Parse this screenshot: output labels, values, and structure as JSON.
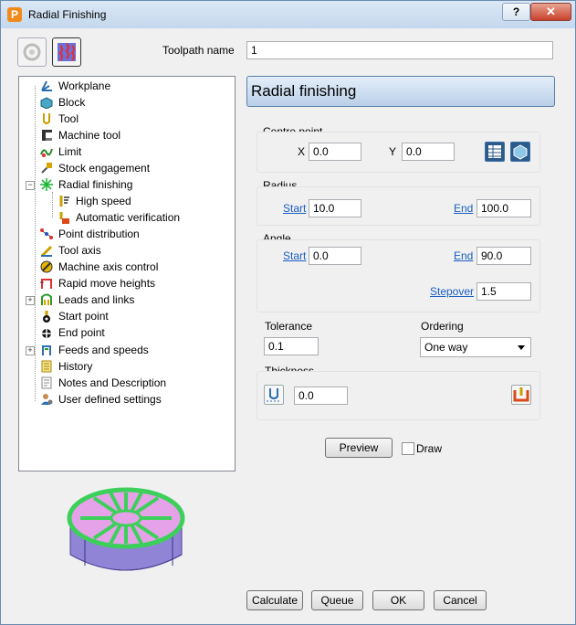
{
  "window": {
    "title": "Radial Finishing",
    "app_icon_letter": "P",
    "help_label": "?",
    "close_label": "✕"
  },
  "toolpath": {
    "label": "Toolpath name",
    "value": "1"
  },
  "tree": {
    "items": [
      {
        "label": "Workplane",
        "icon": "workplane-icon"
      },
      {
        "label": "Block",
        "icon": "block-icon"
      },
      {
        "label": "Tool",
        "icon": "tool-icon"
      },
      {
        "label": "Machine tool",
        "icon": "machine-tool-icon"
      },
      {
        "label": "Limit",
        "icon": "limit-icon"
      },
      {
        "label": "Stock engagement",
        "icon": "stock-engagement-icon"
      },
      {
        "label": "Radial finishing",
        "icon": "radial-finishing-icon"
      },
      {
        "label": "High speed",
        "icon": "high-speed-icon"
      },
      {
        "label": "Automatic verification",
        "icon": "automatic-verification-icon"
      },
      {
        "label": "Point distribution",
        "icon": "point-distribution-icon"
      },
      {
        "label": "Tool axis",
        "icon": "tool-axis-icon"
      },
      {
        "label": "Machine axis control",
        "icon": "machine-axis-control-icon"
      },
      {
        "label": "Rapid move heights",
        "icon": "rapid-move-heights-icon"
      },
      {
        "label": "Leads and links",
        "icon": "leads-and-links-icon"
      },
      {
        "label": "Start point",
        "icon": "start-point-icon"
      },
      {
        "label": "End point",
        "icon": "end-point-icon"
      },
      {
        "label": "Feeds and speeds",
        "icon": "feeds-and-speeds-icon"
      },
      {
        "label": "History",
        "icon": "history-icon"
      },
      {
        "label": "Notes and Description",
        "icon": "notes-icon"
      },
      {
        "label": "User defined settings",
        "icon": "user-settings-icon"
      }
    ],
    "expander_collapse": "−",
    "expander_expand": "+"
  },
  "panel": {
    "title": "Radial finishing",
    "centre": {
      "label": "Centre point",
      "x_label": "X",
      "x_value": "0.0",
      "y_label": "Y",
      "y_value": "0.0"
    },
    "radius": {
      "label": "Radius",
      "start_label": "Start",
      "start_value": "10.0",
      "end_label": "End",
      "end_value": "100.0"
    },
    "angle": {
      "label": "Angle",
      "start_label": "Start",
      "start_value": "0.0",
      "end_label": "End",
      "end_value": "90.0",
      "stepover_label": "Stepover",
      "stepover_value": "1.5"
    },
    "tolerance": {
      "label": "Tolerance",
      "value": "0.1"
    },
    "ordering": {
      "label": "Ordering",
      "value": "One way"
    },
    "thickness": {
      "label": "Thickness",
      "value": "0.0"
    },
    "preview_label": "Preview",
    "draw_label": "Draw"
  },
  "buttons": {
    "calculate": "Calculate",
    "queue": "Queue",
    "ok": "OK",
    "cancel": "Cancel"
  },
  "colors": {
    "accent": "#3c6fa8",
    "preview_green": "#3cd05a",
    "preview_pink": "#e6a2e8",
    "preview_body": "#8f84d6"
  }
}
